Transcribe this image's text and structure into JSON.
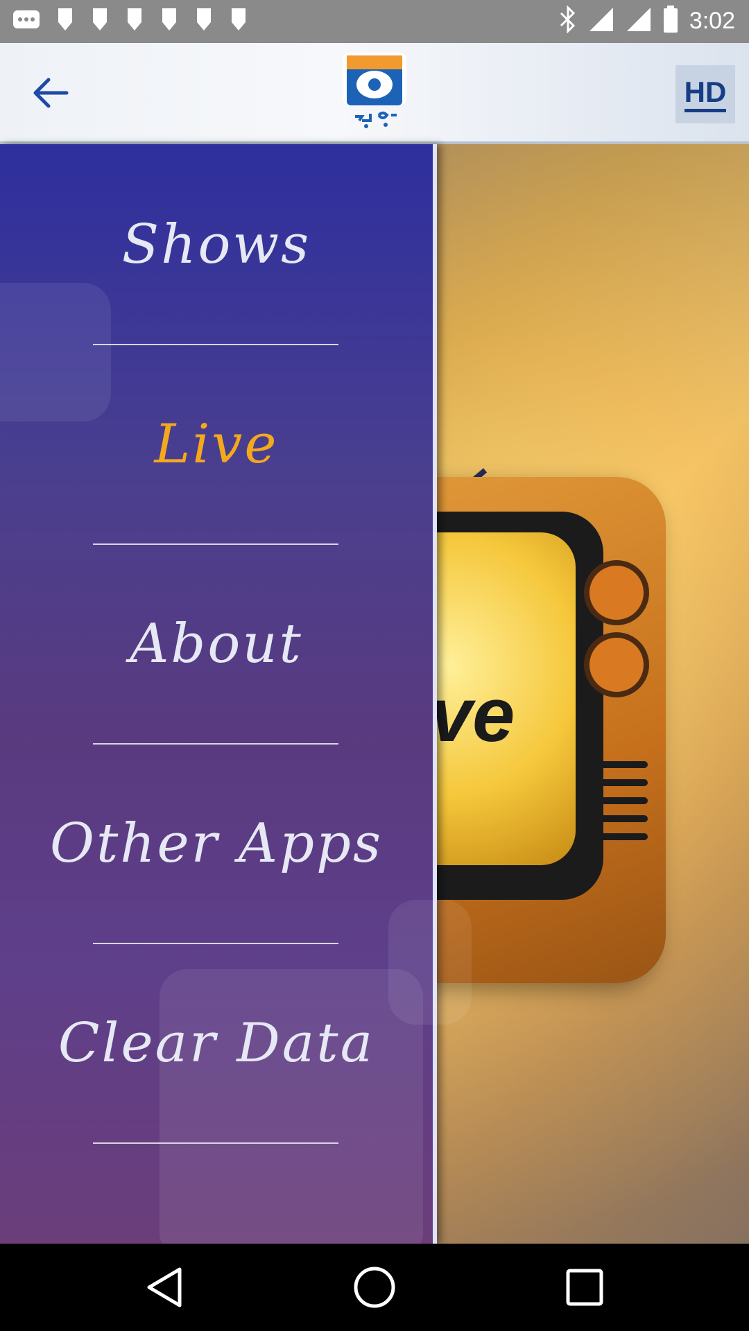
{
  "status_bar": {
    "time": "3:02"
  },
  "app_bar": {
    "hd_label": "HD"
  },
  "menu": {
    "items": [
      {
        "label": "Shows",
        "active": false
      },
      {
        "label": "Live",
        "active": true
      },
      {
        "label": "About",
        "active": false
      },
      {
        "label": "Other Apps",
        "active": false
      },
      {
        "label": "Clear Data",
        "active": false
      }
    ]
  },
  "background": {
    "tv_text": "ve"
  },
  "colors": {
    "active_menu": "#f4a81c",
    "menu_text": "#e6e8f4",
    "logo_blue": "#1c63b8",
    "logo_orange": "#f29a2e"
  }
}
